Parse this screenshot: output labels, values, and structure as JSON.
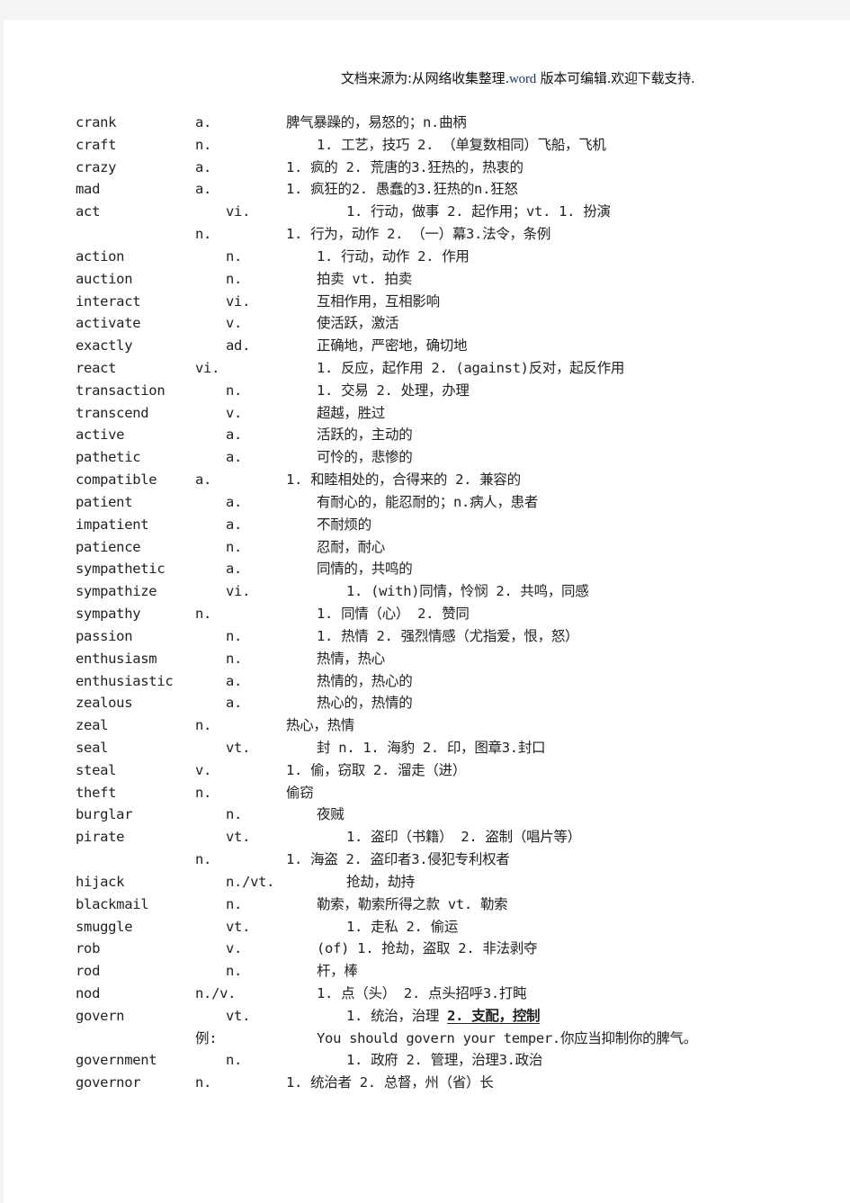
{
  "header": {
    "prefix": "文档来源为:从网络收集整理.",
    "word_label": "word",
    "suffix": " 版本可编辑.欢迎下载支持."
  },
  "entries": [
    {
      "word": "crank",
      "pos": "a.",
      "pos_col": 0,
      "def_col": 1,
      "def": "脾气暴躁的，易怒的；n.曲柄"
    },
    {
      "word": "craft",
      "pos": "n.",
      "pos_col": 0,
      "def_col": 2,
      "def": "1. 工艺，技巧 2. （单复数相同）飞船，飞机"
    },
    {
      "word": "crazy",
      "pos": "a.",
      "pos_col": 0,
      "def_col": 1,
      "def": "1. 疯的 2. 荒唐的3.狂热的，热衷的"
    },
    {
      "word": "mad",
      "pos": "a.",
      "pos_col": 0,
      "def_col": 1,
      "def": "1. 疯狂的2. 愚蠢的3.狂热的n.狂怒"
    },
    {
      "word": "act",
      "pos": "vi.",
      "pos_col": 1,
      "def_col": 3,
      "def": "1. 行动，做事 2. 起作用；vt. 1. 扮演"
    },
    {
      "word": "",
      "pos": "n.",
      "pos_col": 0,
      "def_col": 1,
      "def": "1. 行为，动作 2.  （一）幕3.法令，条例"
    },
    {
      "word": "action",
      "pos": "n.",
      "pos_col": 1,
      "def_col": 2,
      "def": "1. 行动，动作 2.  作用"
    },
    {
      "word": "auction",
      "pos": "n.",
      "pos_col": 1,
      "def_col": 2,
      "def": "拍卖 vt. 拍卖"
    },
    {
      "word": "interact",
      "pos": "vi.",
      "pos_col": 1,
      "def_col": 2,
      "def": "互相作用，互相影响"
    },
    {
      "word": "activate",
      "pos": "v.",
      "pos_col": 1,
      "def_col": 2,
      "def": "使活跃，激活"
    },
    {
      "word": "exactly",
      "pos": "ad.",
      "pos_col": 1,
      "def_col": 2,
      "def": "正确地，严密地，确切地"
    },
    {
      "word": "react",
      "pos": "vi.",
      "pos_col": 0,
      "def_col": 2,
      "def": "1. 反应，起作用 2. (against)反对，起反作用"
    },
    {
      "word": "transaction",
      "pos": "n.",
      "pos_col": 1,
      "def_col": 2,
      "def": "1. 交易 2. 处理，办理"
    },
    {
      "word": "transcend",
      "pos": "v.",
      "pos_col": 1,
      "def_col": 2,
      "def": "超越，胜过"
    },
    {
      "word": "active",
      "pos": "a.",
      "pos_col": 1,
      "def_col": 2,
      "def": "活跃的，主动的"
    },
    {
      "word": "pathetic",
      "pos": "a.",
      "pos_col": 1,
      "def_col": 2,
      "def": "可怜的，悲惨的"
    },
    {
      "word": "compatible",
      "pos": "a.",
      "pos_col": 0,
      "def_col": 1,
      "def": "1. 和睦相处的，合得来的 2. 兼容的"
    },
    {
      "word": "patient",
      "pos": "a.",
      "pos_col": 1,
      "def_col": 2,
      "def": "有耐心的，能忍耐的；n.病人，患者"
    },
    {
      "word": "impatient",
      "pos": "a.",
      "pos_col": 1,
      "def_col": 2,
      "def": "不耐烦的"
    },
    {
      "word": "patience",
      "pos": "n.",
      "pos_col": 1,
      "def_col": 2,
      "def": "忍耐，耐心"
    },
    {
      "word": "sympathetic",
      "pos": "a.",
      "pos_col": 1,
      "def_col": 2,
      "def": "同情的，共鸣的"
    },
    {
      "word": "sympathize",
      "pos": "vi.",
      "pos_col": 1,
      "def_col": 3,
      "def": "1. (with)同情，怜悯 2. 共鸣，同感"
    },
    {
      "word": "sympathy",
      "pos": "n.",
      "pos_col": 0,
      "def_col": 2,
      "def": "1. 同情（心） 2. 赞同"
    },
    {
      "word": "passion",
      "pos": "n.",
      "pos_col": 1,
      "def_col": 2,
      "def": "1. 热情 2. 强烈情感（尤指爱，恨，怒）"
    },
    {
      "word": "enthusiasm",
      "pos": "n.",
      "pos_col": 1,
      "def_col": 2,
      "def": "热情，热心"
    },
    {
      "word": "enthusiastic",
      "pos": "a.",
      "pos_col": 1,
      "def_col": 2,
      "def": "热情的，热心的"
    },
    {
      "word": "zealous",
      "pos": "a.",
      "pos_col": 1,
      "def_col": 2,
      "def": "热心的，热情的"
    },
    {
      "word": "zeal",
      "pos": "n.",
      "pos_col": 0,
      "def_col": 1,
      "def": "热心，热情"
    },
    {
      "word": "seal",
      "pos": "vt.",
      "pos_col": 1,
      "def_col": 2,
      "def": "封 n. 1. 海豹 2. 印，图章3.封口"
    },
    {
      "word": "steal",
      "pos": "v.",
      "pos_col": 0,
      "def_col": 1,
      "def": "1. 偷，窃取 2. 溜走（进）"
    },
    {
      "word": "theft",
      "pos": "n.",
      "pos_col": 0,
      "def_col": 1,
      "def": "偷窃"
    },
    {
      "word": "burglar",
      "pos": "n.",
      "pos_col": 1,
      "def_col": 2,
      "def": "夜贼"
    },
    {
      "word": "pirate",
      "pos": "vt.",
      "pos_col": 1,
      "def_col": 3,
      "def": "1. 盗印（书籍） 2. 盗制（唱片等）"
    },
    {
      "word": "",
      "pos": "n.",
      "pos_col": 0,
      "def_col": 1,
      "def": "1. 海盗 2. 盗印者3.侵犯专利权者"
    },
    {
      "word": "hijack",
      "pos": "n./vt.",
      "pos_col": 1,
      "def_col": 3,
      "def": "抢劫，劫持"
    },
    {
      "word": "blackmail",
      "pos": "n.",
      "pos_col": 1,
      "def_col": 2,
      "def": "勒索，勒索所得之款   vt.    勒索"
    },
    {
      "word": "smuggle",
      "pos": "vt.",
      "pos_col": 1,
      "def_col": 3,
      "def": "1. 走私 2. 偷运"
    },
    {
      "word": "rob",
      "pos": "v.",
      "pos_col": 1,
      "def_col": 2,
      "def": "(of) 1. 抢劫，盗取 2. 非法剥夺"
    },
    {
      "word": "rod",
      "pos": "n.",
      "pos_col": 1,
      "def_col": 2,
      "def": "杆，棒"
    },
    {
      "word": "nod",
      "pos": "n./v.",
      "pos_col": 0,
      "def_col": 2,
      "def": "1. 点（头） 2. 点头招呼3.打盹"
    },
    {
      "word": "govern",
      "pos": "vt.",
      "pos_col": 1,
      "def_col": 3,
      "def": "1. 统治，治理 ",
      "def_emph": "2. 支配，控制"
    },
    {
      "word": "",
      "pos": "例:",
      "pos_col": 0,
      "def_col": 2,
      "def": "You should govern your temper.你应当抑制你的脾气。"
    },
    {
      "word": "government",
      "pos": "n.",
      "pos_col": 1,
      "def_col": 3,
      "def": "1. 政府 2. 管理，治理3.政治"
    },
    {
      "word": "governor",
      "pos": "n.",
      "pos_col": 0,
      "def_col": 1,
      "def": "1. 统治者 2. 总督，州（省）长"
    }
  ]
}
